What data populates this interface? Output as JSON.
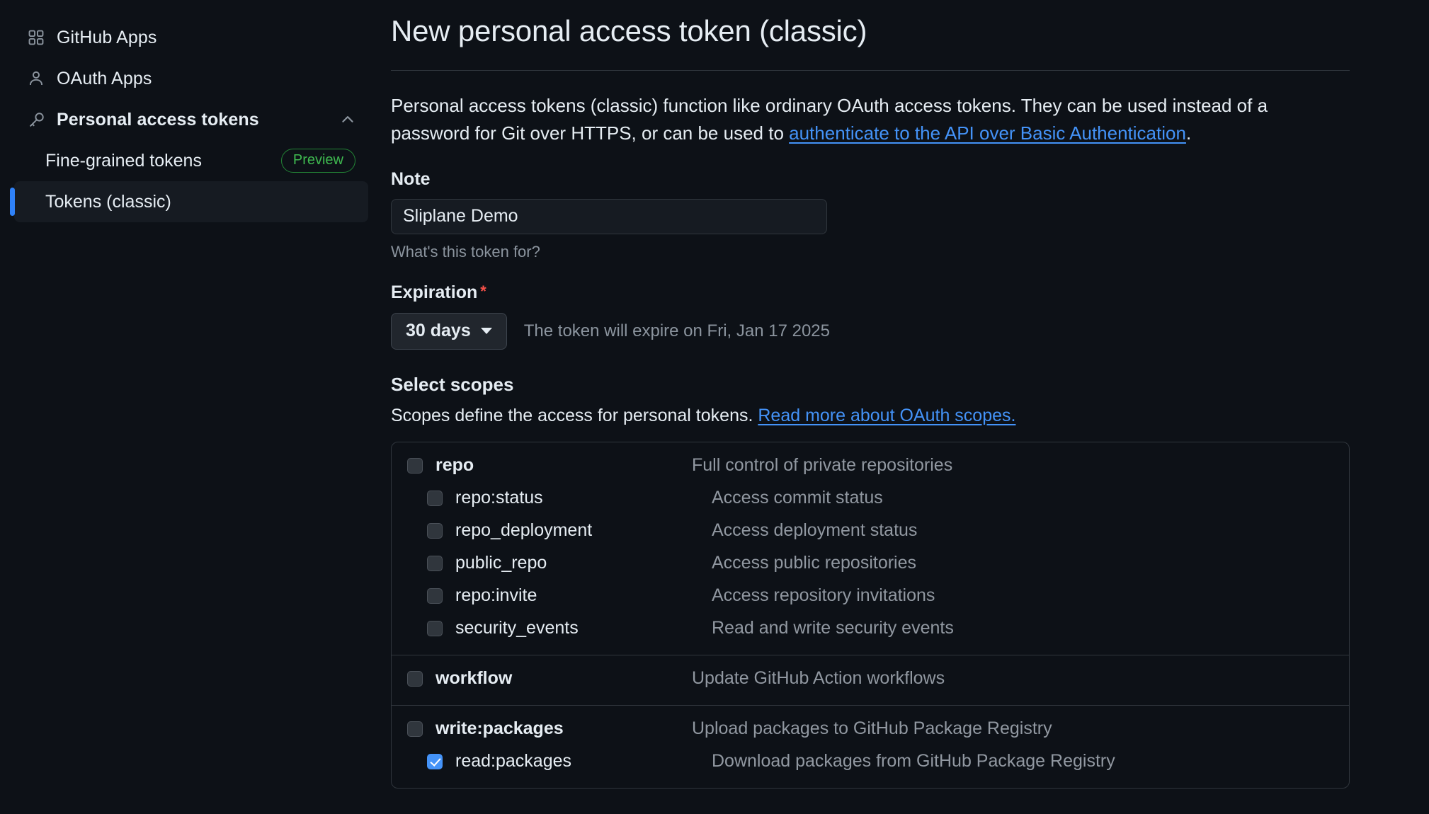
{
  "sidebar": {
    "items": [
      {
        "label": "GitHub Apps",
        "icon": "apps-grid-icon",
        "name": "sidebar-item-github-apps"
      },
      {
        "label": "OAuth Apps",
        "icon": "person-icon",
        "name": "sidebar-item-oauth-apps"
      },
      {
        "label": "Personal access tokens",
        "icon": "key-icon",
        "name": "sidebar-item-personal-access-tokens",
        "expanded": true,
        "chevron": "chevron-up-icon"
      }
    ],
    "sub_items": [
      {
        "label": "Fine-grained tokens",
        "badge": "Preview",
        "active": false,
        "name": "sidebar-item-fine-grained-tokens"
      },
      {
        "label": "Tokens (classic)",
        "badge": "",
        "active": true,
        "name": "sidebar-item-tokens-classic"
      }
    ]
  },
  "main": {
    "title": "New personal access token (classic)",
    "intro_part1": "Personal access tokens (classic) function like ordinary OAuth access tokens. They can be used instead of a password for Git over HTTPS, or can be used to ",
    "intro_link": "authenticate to the API over Basic Authentication",
    "intro_part2": ".",
    "note": {
      "label": "Note",
      "value": "Sliplane Demo",
      "placeholder": "What's this token for?",
      "hint": "What's this token for?"
    },
    "expiration": {
      "label": "Expiration",
      "required_mark": "*",
      "selected": "30 days",
      "note": "The token will expire on Fri, Jan 17 2025"
    },
    "scopes": {
      "title": "Select scopes",
      "subtitle_text": "Scopes define the access for personal tokens. ",
      "subtitle_link": "Read more about OAuth scopes."
    }
  },
  "scope_groups": [
    {
      "rows": [
        {
          "name": "repo",
          "desc": "Full control of private repositories",
          "child": false,
          "checked": false
        },
        {
          "name": "repo:status",
          "desc": "Access commit status",
          "child": true,
          "checked": false
        },
        {
          "name": "repo_deployment",
          "desc": "Access deployment status",
          "child": true,
          "checked": false
        },
        {
          "name": "public_repo",
          "desc": "Access public repositories",
          "child": true,
          "checked": false
        },
        {
          "name": "repo:invite",
          "desc": "Access repository invitations",
          "child": true,
          "checked": false
        },
        {
          "name": "security_events",
          "desc": "Read and write security events",
          "child": true,
          "checked": false
        }
      ]
    },
    {
      "rows": [
        {
          "name": "workflow",
          "desc": "Update GitHub Action workflows",
          "child": false,
          "checked": false
        }
      ]
    },
    {
      "rows": [
        {
          "name": "write:packages",
          "desc": "Upload packages to GitHub Package Registry",
          "child": false,
          "checked": false
        },
        {
          "name": "read:packages",
          "desc": "Download packages from GitHub Package Registry",
          "child": true,
          "checked": true
        }
      ]
    }
  ],
  "colors": {
    "background": "#0d1117",
    "accent_blue": "#4493f8",
    "active_bar": "#2f81f7",
    "preview_green": "#3fb950",
    "required_red": "#f85149",
    "muted_text": "#9198a1",
    "border": "#30363d"
  }
}
